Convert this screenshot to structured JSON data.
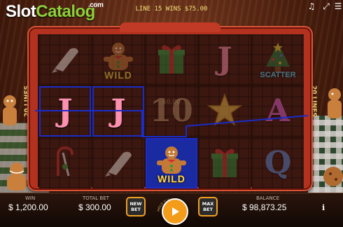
{
  "logo": {
    "part1": "Slot",
    "part2": "Catalog",
    "suffix": ".com"
  },
  "status_message": "LINE 15 WINS $75.00",
  "side_labels": {
    "left": "20 LINES",
    "right": "20 LINES"
  },
  "reels": [
    [
      {
        "symbol": "cookie-bag-icon"
      },
      {
        "symbol": "letter-j",
        "text": "J",
        "highlight": true
      },
      {
        "symbol": "candy-cane-icon"
      }
    ],
    [
      {
        "symbol": "gingerbread-wild",
        "label": "WILD"
      },
      {
        "symbol": "letter-j",
        "text": "J",
        "highlight": true
      },
      {
        "symbol": "cookie-bag-icon"
      }
    ],
    [
      {
        "symbol": "gift-box-icon"
      },
      {
        "symbol": "number-10",
        "text": "10",
        "watermark": "$0.00"
      },
      {
        "symbol": "gingerbread-wild",
        "label": "WILD",
        "highlight": true
      }
    ],
    [
      {
        "symbol": "letter-j",
        "text": "J"
      },
      {
        "symbol": "gold-star-icon"
      },
      {
        "symbol": "gift-box-icon"
      }
    ],
    [
      {
        "symbol": "christmas-tree-scatter",
        "label": "SCATTER"
      },
      {
        "symbol": "letter-a",
        "text": "A"
      },
      {
        "symbol": "letter-q",
        "text": "Q"
      }
    ]
  ],
  "bottom_bar": {
    "win_label": "WIN",
    "win_value": "$ 1,200.00",
    "total_bet_label": "TOTAL BET",
    "total_bet_value": "$ 300.00",
    "new_bet_label": "NEW BET",
    "autospin_hint": "HOLD FOR AUTOSPIN",
    "max_bet_label": "MAX BET",
    "balance_label": "BALANCE",
    "balance_value": "$ 98,873.25",
    "info_label": "i"
  },
  "colors": {
    "accent": "#f39c1a",
    "frame": "#b2311f",
    "payline": "#1b2cc8",
    "logo_green": "#8cd03a"
  }
}
